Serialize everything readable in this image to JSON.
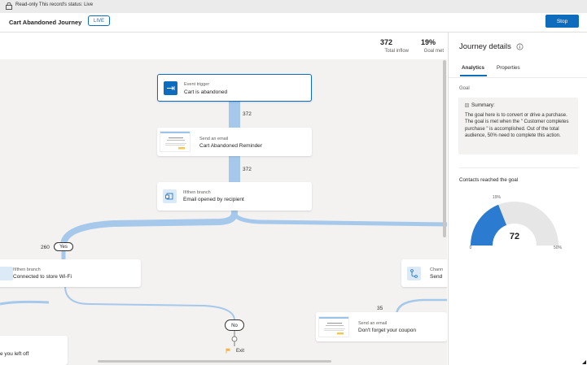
{
  "readonly_bar": {
    "text": "Read-only This record's status: Live"
  },
  "header": {
    "title": "Cart Abandoned Journey",
    "status_badge": "LIVE",
    "stop_label": "Stop"
  },
  "stats": {
    "total_inflow": "372",
    "total_inflow_label": "Total inflow",
    "goal_met": "19%",
    "goal_met_label": "Goal met"
  },
  "canvas": {
    "trigger": {
      "subtitle": "Event trigger",
      "title": "Cart is abandoned"
    },
    "email1": {
      "subtitle": "Send an email",
      "title": "Cart Abandoned Reminder"
    },
    "branch1": {
      "subtitle": "If/then branch",
      "title": "Email opened by recipient"
    },
    "branch2": {
      "subtitle": "If/then branch",
      "title": "Connected to store Wi-Fi"
    },
    "channel": {
      "subtitle": "Chann",
      "title": "Send"
    },
    "email2": {
      "subtitle": "Send an email",
      "title": "Don't forget your coupon"
    },
    "left_partial": {
      "title": "e you left off"
    },
    "count_1": "372",
    "count_2": "372",
    "count_yes": "260",
    "count_right": "35",
    "yes_label": "Yes",
    "no_label": "No",
    "exit_label": "Exit"
  },
  "panel": {
    "title": "Journey details",
    "tabs": [
      {
        "label": "Analytics"
      },
      {
        "label": "Properties"
      }
    ],
    "goal_label": "Goal",
    "summary_heading": "Summary:",
    "summary_text": "The goal here is to convert or drive a purchase. The goal is met when the \" Customer completes purchase \" is accomplished. Out of the total audience, 50% need to complete this action.",
    "contacts_label": "Contacts reached the goal",
    "gauge": {
      "value": "72",
      "min_label": "0",
      "max_label": "50%",
      "marker_label": "19%",
      "fill_fraction": 0.38,
      "color": "#2b7bd0",
      "track_color": "#e6e6e6"
    }
  },
  "colors": {
    "accent": "#0f6cbd",
    "flow_line": "#a6c8ea",
    "canvas_bg": "#f3f2f1"
  },
  "icons": {
    "lock": "lock-icon",
    "info": "info-icon",
    "trigger": "arrow-right-to-bar-icon",
    "branch": "branch-icon",
    "channel": "channel-branch-icon",
    "summary": "summary-icon",
    "exit": "flag-icon"
  }
}
